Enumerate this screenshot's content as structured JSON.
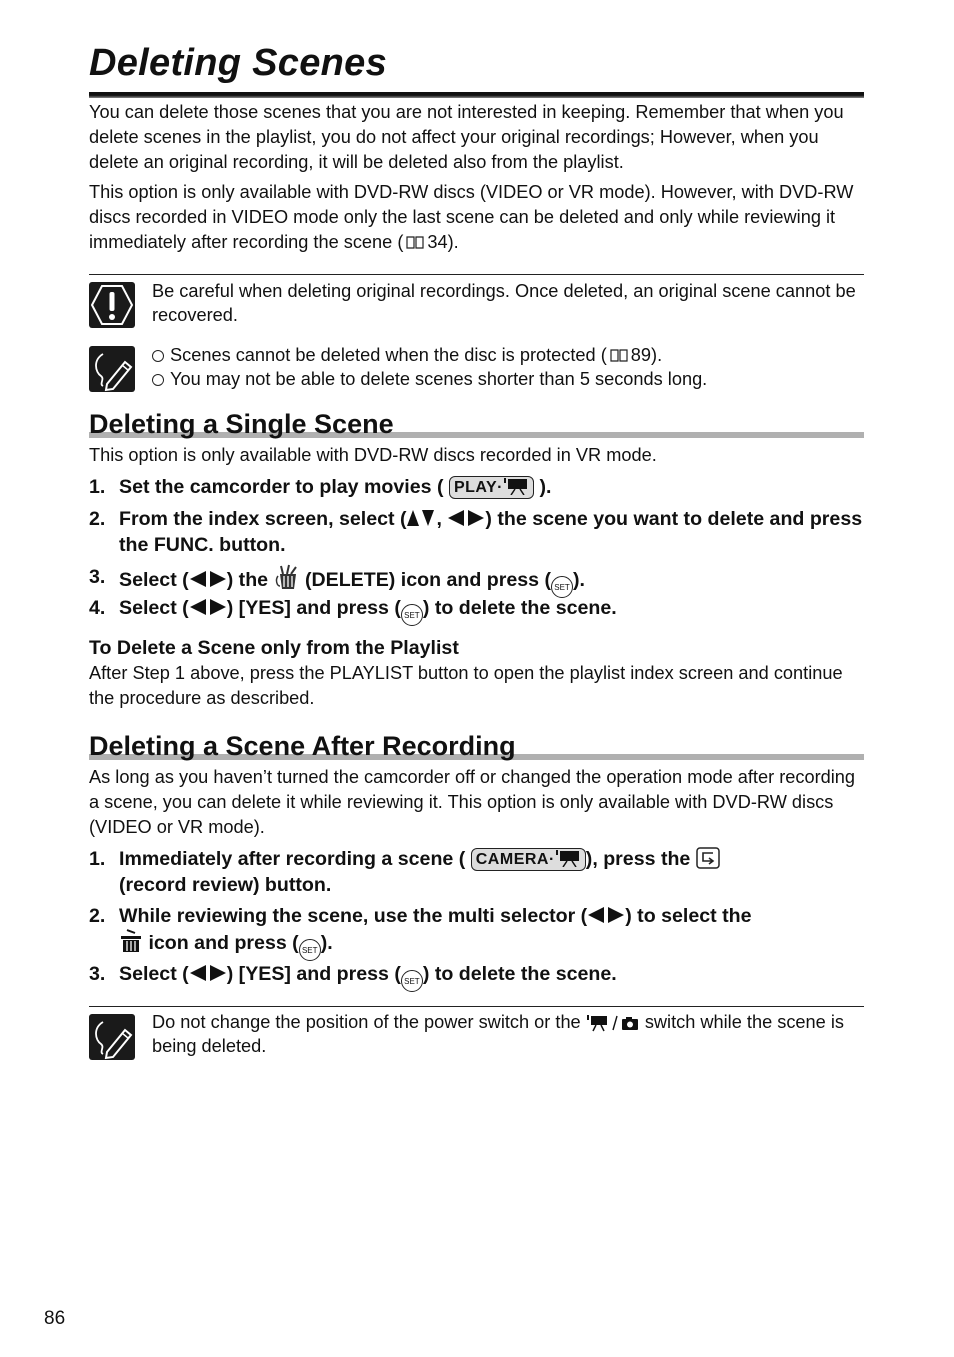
{
  "title": "Deleting Scenes",
  "intro": {
    "p1": "You can delete those scenes that you are not interested in keeping. Remember that when you delete scenes in the playlist, you do not affect your original recordings; However, when you delete an original recording, it will be deleted also from the playlist.",
    "p2_before": "This option is only available with DVD-RW discs (VIDEO or VR mode). However, with DVD-RW discs recorded in VIDEO mode only the last scene can be deleted and only while reviewing it immediately after recording the scene (",
    "p2_ref": "34",
    "p2_after": ")."
  },
  "caution": {
    "icon": "caution-icon",
    "text": "Be careful when deleting original recordings. Once deleted, an original scene cannot be recovered."
  },
  "notes1": {
    "icon": "note-pencil-icon",
    "items": [
      {
        "before": "Scenes cannot be deleted when the disc is protected (",
        "ref": "89",
        "after": ")."
      },
      {
        "before": "You may not be able to delete scenes shorter than 5 seconds long.",
        "ref": "",
        "after": ""
      }
    ]
  },
  "section1": {
    "heading": "Deleting a Single Scene",
    "intro": "This option is only available with DVD-RW discs recorded in VR mode.",
    "steps": [
      {
        "num": "1.",
        "a": "Set the camcorder to play movies (",
        "mode": "PLAY",
        "b": ")."
      },
      {
        "num": "2.",
        "a": "From the index screen, select (",
        "b": ",",
        "c": ") the scene you want to delete and press the FUNC. button."
      },
      {
        "num": "3.",
        "a": "Select (",
        "b": ") the",
        "c": "(DELETE) icon and press (",
        "d": ")."
      },
      {
        "num": "4.",
        "a": "Select (",
        "b": ") [YES] and press (",
        "c": ") to delete the scene."
      }
    ],
    "sub_heading": "To Delete a Scene only from the Playlist",
    "sub_text": "After Step 1 above, press the PLAYLIST button to open the playlist index screen and continue the procedure as described."
  },
  "section2": {
    "heading": "Deleting a Scene After Recording",
    "intro": "As long as you haven’t turned the camcorder off or changed the operation mode after recording a scene, you can delete it while reviewing it. This option is only available with DVD-RW discs (VIDEO or VR mode).",
    "steps": [
      {
        "num": "1.",
        "a": "Immediately after recording a scene (",
        "mode": "CAMERA",
        "b": "), press the",
        "c": "(record review) button."
      },
      {
        "num": "2.",
        "a": "While reviewing the scene, use the multi selector (",
        "b": ") to select the",
        "c": "icon and press (",
        "d": ")."
      },
      {
        "num": "3.",
        "a": "Select (",
        "b": ") [YES] and press (",
        "c": ") to delete the scene."
      }
    ]
  },
  "notes2": {
    "icon": "note-pencil-icon",
    "before": "Do not change the position of the power switch or the",
    "after": "switch while the scene is being deleted."
  },
  "set_label": "SET",
  "page_number": "86"
}
